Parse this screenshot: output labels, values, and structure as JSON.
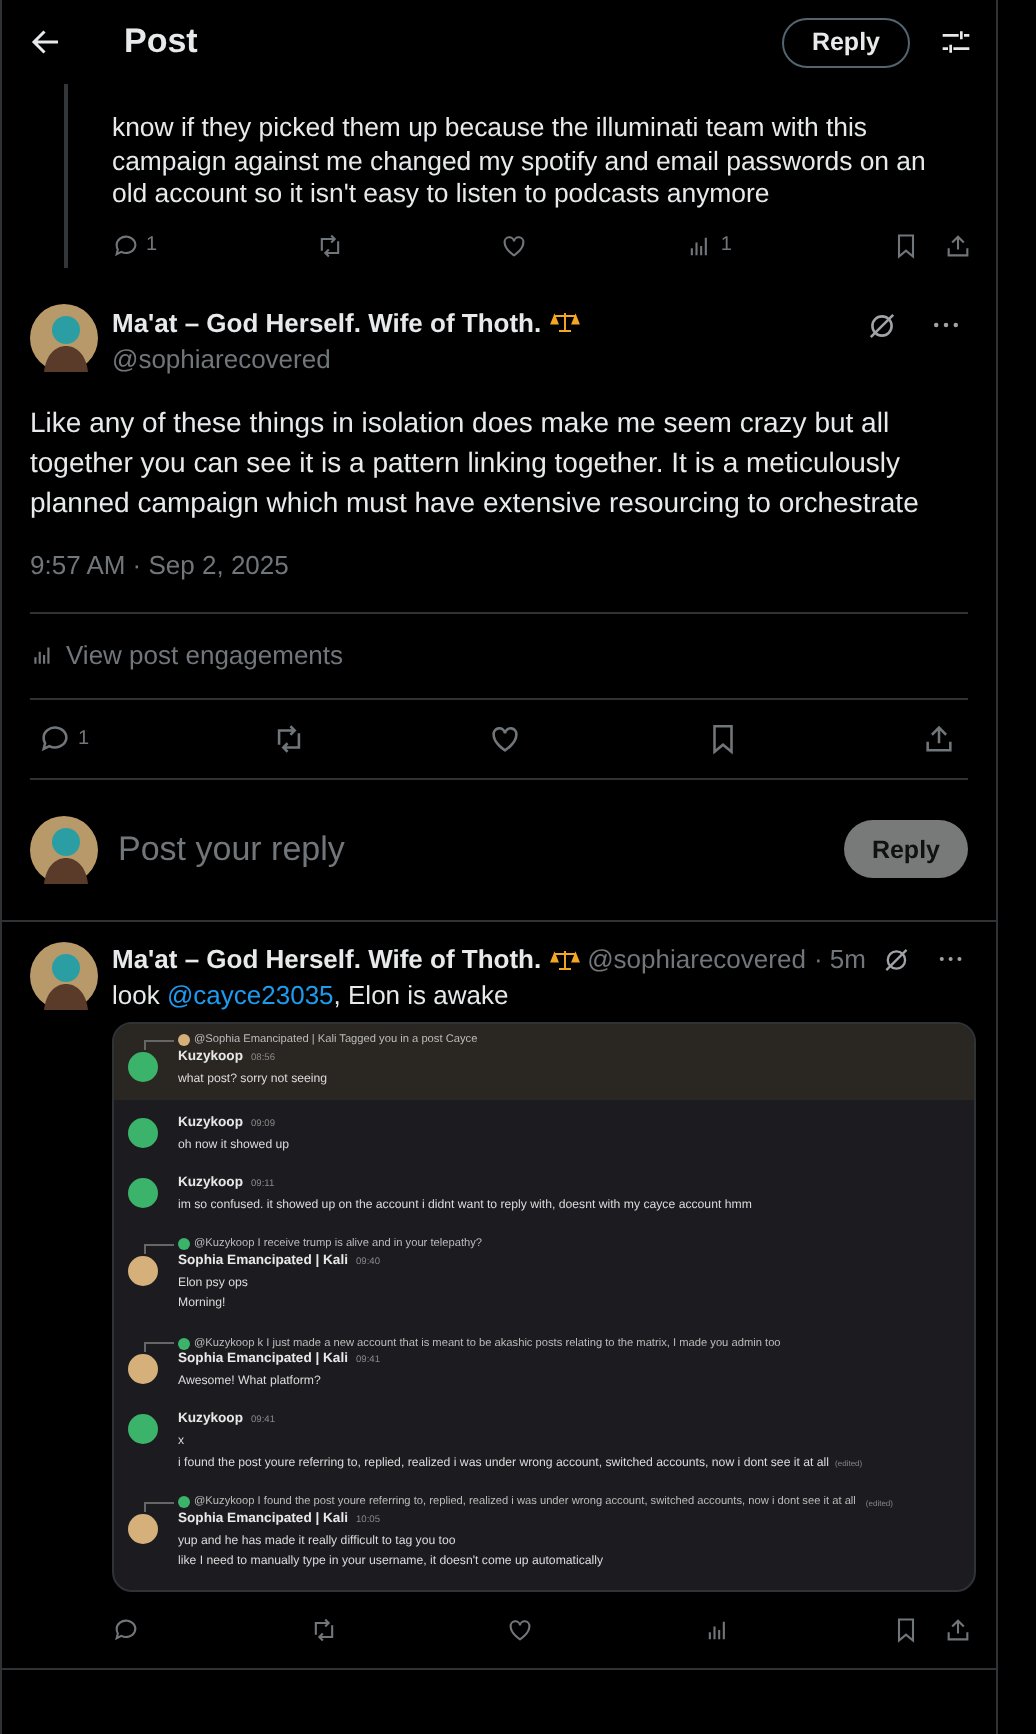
{
  "header": {
    "title": "Post",
    "reply_button": "Reply"
  },
  "parent_post": {
    "text": "know if they picked them up because the illuminati team with this campaign against me changed my spotify and email passwords on an old account so it isn't easy to listen to podcasts anymore",
    "actions": [
      {
        "kind": "reply",
        "count": "1"
      },
      {
        "kind": "repost"
      },
      {
        "kind": "like"
      },
      {
        "kind": "views",
        "count": "1"
      },
      {
        "kind": "bookmark"
      },
      {
        "kind": "share"
      }
    ]
  },
  "main_post": {
    "name": "Ma'at – God Herself. Wife of Thoth.",
    "handle": "@sophiarecovered",
    "text": "Like any of these things in isolation does make me seem crazy but all together you can see it is a pattern linking together. It is a meticulously planned campaign which must have extensive resourcing to orchestrate",
    "timestamp": "9:57 AM · Sep 2, 2025",
    "engagements": "View post engagements",
    "actions": [
      {
        "kind": "reply",
        "count": "1"
      },
      {
        "kind": "repost"
      },
      {
        "kind": "like"
      },
      {
        "kind": "bookmark"
      },
      {
        "kind": "share"
      }
    ]
  },
  "composer": {
    "placeholder": "Post your reply",
    "button": "Reply"
  },
  "reply_post": {
    "name": "Ma'at – God Herself. Wife of Thoth.",
    "handle": "@sophiarecovered",
    "age": "· 5m",
    "text_before": "look ",
    "mention": "@cayce23035",
    "text_after": ", Elon is awake",
    "image_messages": [
      {
        "reply_to": "@Sophia Emancipated | Kali Tagged you in a post Cayce",
        "author": "Kuzykoop",
        "time": "08:56",
        "color": "#3bb36a",
        "highlighted": true,
        "lines": [
          {
            "text": "what post? sorry not seeing"
          }
        ]
      },
      {
        "author": "Kuzykoop",
        "time": "09:09",
        "color": "#3bb36a",
        "highlighted": false,
        "lines": [
          {
            "text": "oh now it showed up"
          }
        ]
      },
      {
        "author": "Kuzykoop",
        "time": "09:11",
        "color": "#3bb36a",
        "highlighted": false,
        "lines": [
          {
            "text": "im so confused. it showed up on the account i didnt want to reply with, doesnt with my cayce account hmm"
          }
        ]
      },
      {
        "reply_to": "@Kuzykoop I receive trump is alive and in your telepathy?",
        "author": "Sophia Emancipated | Kali",
        "time": "09:40",
        "color": "#d6b07a",
        "highlighted": false,
        "lines": [
          {
            "text": "Elon psy ops"
          },
          {
            "text": "Morning!"
          }
        ]
      },
      {
        "reply_to": "@Kuzykoop k I just made a new account that is meant to be akashic posts relating to the matrix, I made you admin too",
        "author": "Sophia Emancipated | Kali",
        "time": "09:41",
        "color": "#d6b07a",
        "highlighted": false,
        "lines": [
          {
            "text": "Awesome!  What platform?"
          }
        ]
      },
      {
        "author": "Kuzykoop",
        "time": "09:41",
        "color": "#3bb36a",
        "highlighted": false,
        "lines": [
          {
            "text": "x"
          },
          {
            "text": "i found the post youre referring to, replied, realized i was under wrong account, switched accounts, now i dont see it at all",
            "edited": "(edited)"
          }
        ]
      },
      {
        "reply_to": "@Kuzykoop I found the post youre referring to, replied, realized i was under wrong account, switched accounts, now i dont see it at all",
        "reply_edited": "(edited)",
        "author": "Sophia Emancipated | Kali",
        "time": "10:05",
        "color": "#d6b07a",
        "highlighted": false,
        "lines": [
          {
            "text": "yup and he has made it really difficult to tag you too"
          },
          {
            "text": "like I need to manually type in your username, it doesn't come up automatically"
          }
        ]
      }
    ],
    "actions": [
      {
        "kind": "reply"
      },
      {
        "kind": "repost"
      },
      {
        "kind": "like"
      },
      {
        "kind": "views"
      },
      {
        "kind": "bookmark"
      },
      {
        "kind": "share"
      }
    ]
  }
}
